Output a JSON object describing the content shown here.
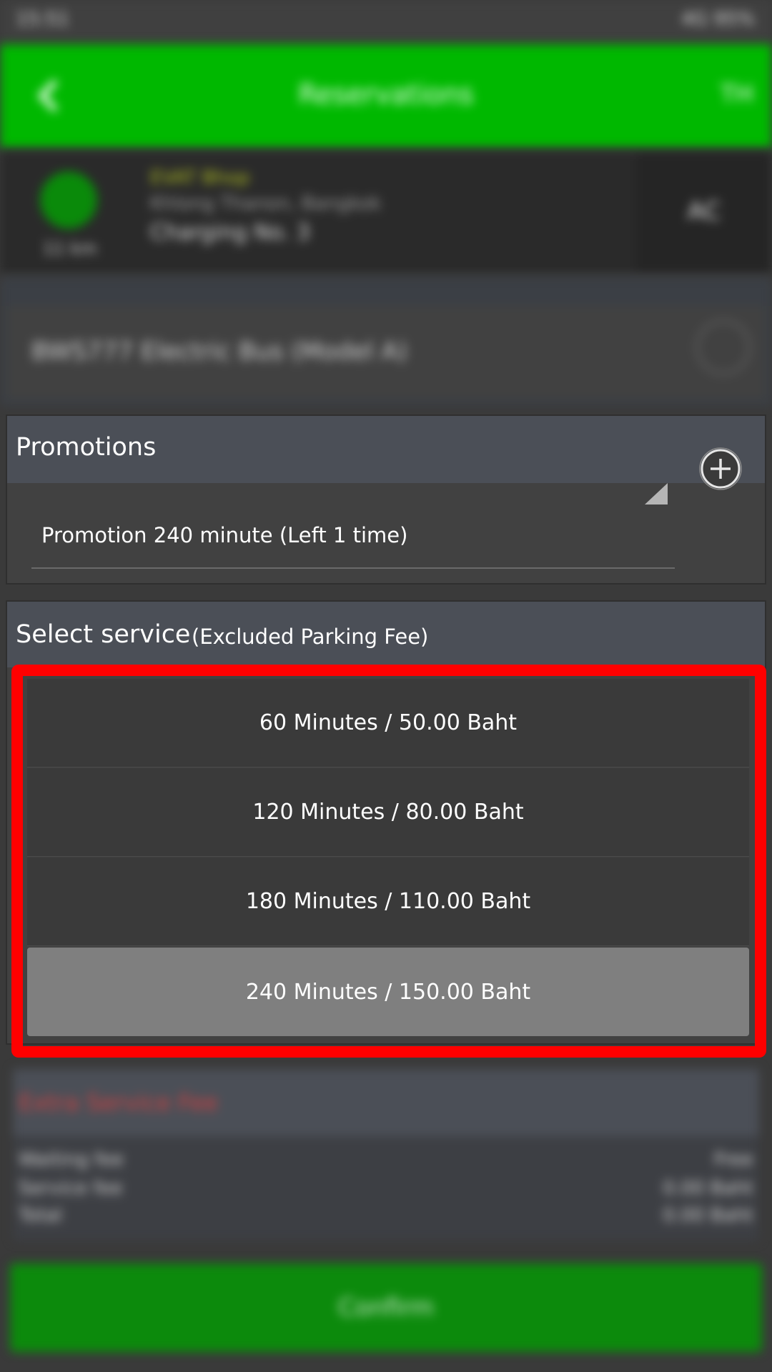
{
  "status_bar": {
    "time": "15:51",
    "right": "4G 95%"
  },
  "app_bar": {
    "title": "Reservations",
    "lang": "TH"
  },
  "station": {
    "name": "EVAT Bhop",
    "address": "Khlong Thanon, Bangkok",
    "charger": "Charging No. 3",
    "distance": "11 km",
    "side": "AC"
  },
  "vehicle": {
    "value": "BWS777 Electric Bus (Model A)"
  },
  "promotions": {
    "title": "Promotions",
    "selected": "Promotion 240 minute (Left 1 time)"
  },
  "service": {
    "title": "Select service",
    "note": "(Excluded Parking Fee)",
    "options": [
      {
        "label": "60 Minutes / 50.00 Baht",
        "selected": false
      },
      {
        "label": "120 Minutes / 80.00 Baht",
        "selected": false
      },
      {
        "label": "180 Minutes / 110.00 Baht",
        "selected": false
      },
      {
        "label": "240 Minutes / 150.00 Baht",
        "selected": true
      }
    ]
  },
  "summary": {
    "title": "Extra Service Fee",
    "rows": [
      {
        "label": "Waiting fee",
        "value": "Free"
      },
      {
        "label": "Service fee",
        "value": "0.00 Baht"
      },
      {
        "label": "Total",
        "value": "0.00 Baht"
      }
    ]
  },
  "confirm": {
    "label": "Confirm"
  },
  "colors": {
    "brand_green": "#00b800",
    "highlight": "#ff0000",
    "selected_option": "#7f7f7f"
  }
}
